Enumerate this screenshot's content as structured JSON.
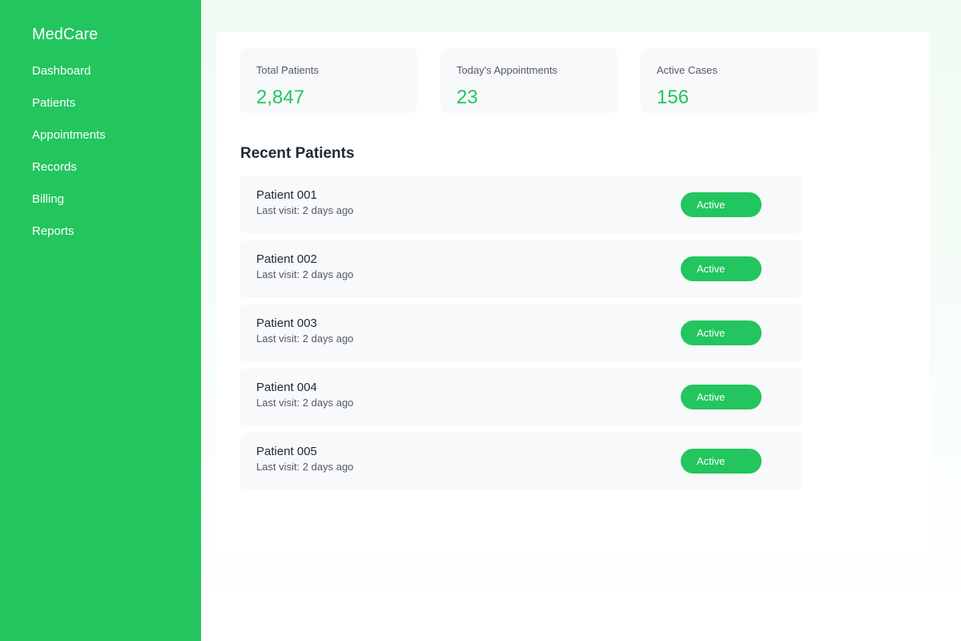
{
  "sidebar": {
    "brand": "MedCare",
    "items": [
      {
        "label": "Dashboard"
      },
      {
        "label": "Patients"
      },
      {
        "label": "Appointments"
      },
      {
        "label": "Records"
      },
      {
        "label": "Billing"
      },
      {
        "label": "Reports"
      }
    ]
  },
  "stats": [
    {
      "label": "Total Patients",
      "value": "2,847"
    },
    {
      "label": "Today's Appointments",
      "value": "23"
    },
    {
      "label": "Active Cases",
      "value": "156"
    }
  ],
  "recent": {
    "title": "Recent Patients",
    "patients": [
      {
        "name": "Patient 001",
        "visit": "Last visit: 2 days ago",
        "status": "Active"
      },
      {
        "name": "Patient 002",
        "visit": "Last visit: 2 days ago",
        "status": "Active"
      },
      {
        "name": "Patient 003",
        "visit": "Last visit: 2 days ago",
        "status": "Active"
      },
      {
        "name": "Patient 004",
        "visit": "Last visit: 2 days ago",
        "status": "Active"
      },
      {
        "name": "Patient 005",
        "visit": "Last visit: 2 days ago",
        "status": "Active"
      }
    ]
  },
  "colors": {
    "accent": "#22c55e",
    "card": "#f8f9fb",
    "text": "#1f2937",
    "muted": "#555b63"
  }
}
